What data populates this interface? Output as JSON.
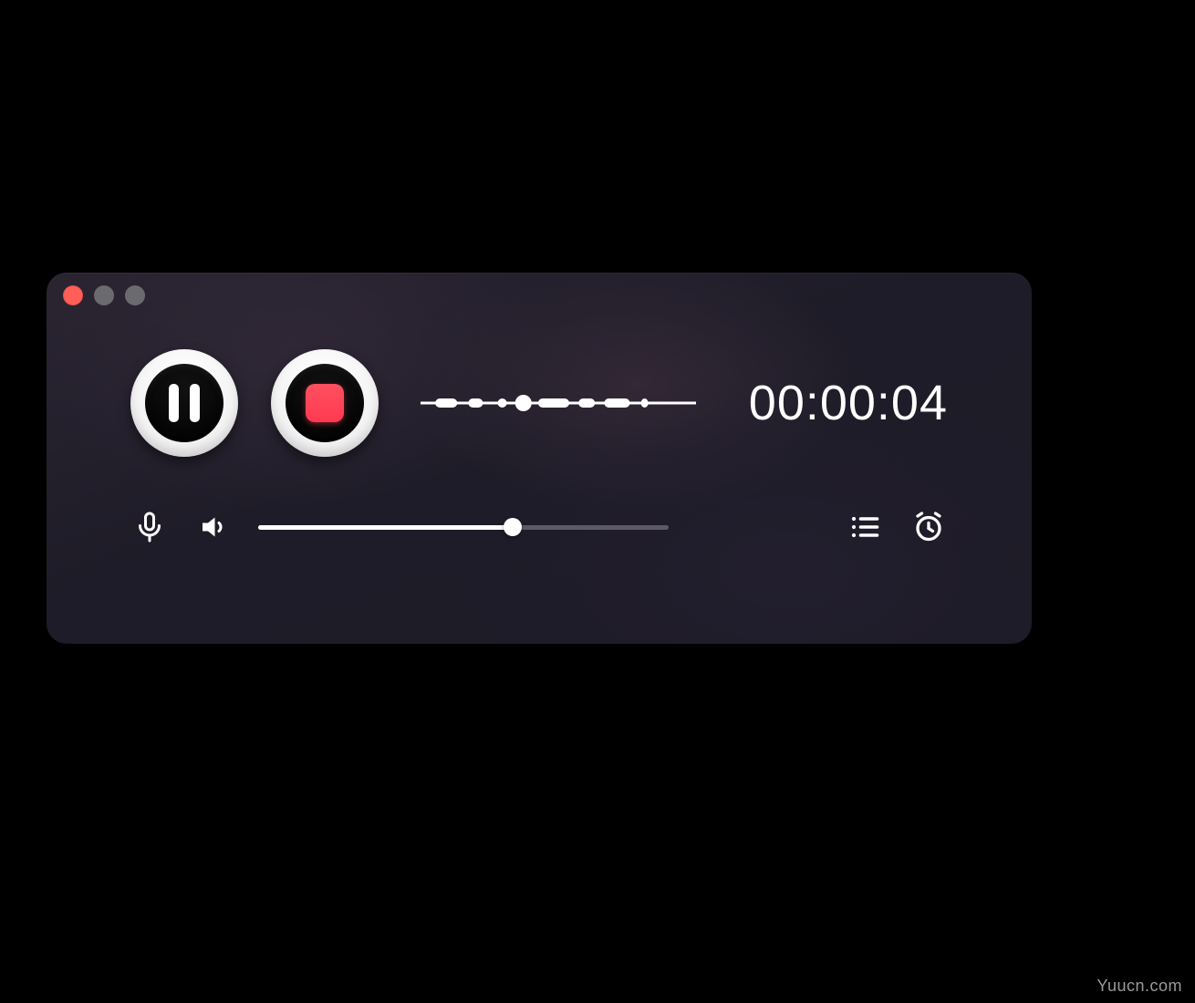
{
  "window": {
    "traffic_lights": {
      "close": "close",
      "minimize": "minimize",
      "maximize": "maximize"
    }
  },
  "recorder": {
    "pause_label": "Pause",
    "stop_label": "Stop",
    "elapsed_time": "00:00:04",
    "volume_percent": 62
  },
  "controls": {
    "microphone": "microphone",
    "speaker": "speaker",
    "list": "recordings-list",
    "timer": "timer"
  },
  "watermark": "Yuucn.com",
  "colors": {
    "record_red": "#ff3a50",
    "window_bg": "#201d29",
    "text": "#ffffff"
  }
}
